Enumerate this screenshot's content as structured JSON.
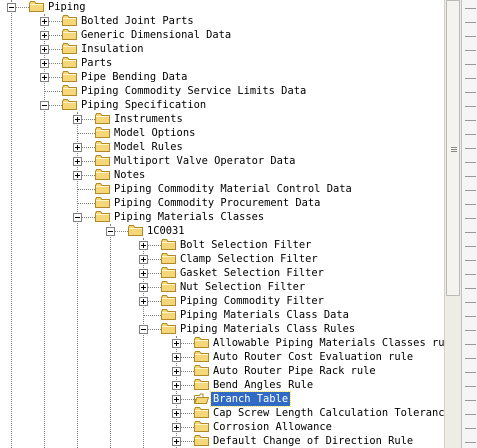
{
  "tree": [
    {
      "label": "Piping",
      "level": 0,
      "state": "minus"
    },
    {
      "label": "Bolted Joint Parts",
      "level": 1,
      "state": "plus"
    },
    {
      "label": "Generic Dimensional Data",
      "level": 1,
      "state": "plus"
    },
    {
      "label": "Insulation",
      "level": 1,
      "state": "plus"
    },
    {
      "label": "Parts",
      "level": 1,
      "state": "plus"
    },
    {
      "label": "Pipe Bending Data",
      "level": 1,
      "state": "plus"
    },
    {
      "label": "Piping Commodity Service Limits Data",
      "level": 1,
      "state": "none"
    },
    {
      "label": "Piping Specification",
      "level": 1,
      "state": "minus"
    },
    {
      "label": "Instruments",
      "level": 2,
      "state": "plus"
    },
    {
      "label": "Model Options",
      "level": 2,
      "state": "none"
    },
    {
      "label": "Model Rules",
      "level": 2,
      "state": "plus"
    },
    {
      "label": "Multiport Valve Operator Data",
      "level": 2,
      "state": "plus"
    },
    {
      "label": "Notes",
      "level": 2,
      "state": "plus"
    },
    {
      "label": "Piping Commodity Material Control Data",
      "level": 2,
      "state": "none"
    },
    {
      "label": "Piping Commodity Procurement Data",
      "level": 2,
      "state": "none"
    },
    {
      "label": "Piping Materials Classes",
      "level": 2,
      "state": "minus"
    },
    {
      "label": "1C0031",
      "level": 3,
      "state": "minus"
    },
    {
      "label": "Bolt Selection Filter",
      "level": 4,
      "state": "plus"
    },
    {
      "label": "Clamp Selection Filter",
      "level": 4,
      "state": "plus"
    },
    {
      "label": "Gasket Selection Filter",
      "level": 4,
      "state": "plus"
    },
    {
      "label": "Nut Selection Filter",
      "level": 4,
      "state": "plus"
    },
    {
      "label": "Piping Commodity Filter",
      "level": 4,
      "state": "plus"
    },
    {
      "label": "Piping Materials Class Data",
      "level": 4,
      "state": "none"
    },
    {
      "label": "Piping Materials Class Rules",
      "level": 4,
      "state": "minus"
    },
    {
      "label": "Allowable Piping Materials Classes ru",
      "level": 5,
      "state": "plus"
    },
    {
      "label": "Auto Router Cost Evaluation rule",
      "level": 5,
      "state": "plus"
    },
    {
      "label": "Auto Router Pipe Rack rule",
      "level": 5,
      "state": "plus"
    },
    {
      "label": "Bend Angles Rule",
      "level": 5,
      "state": "plus"
    },
    {
      "label": "Branch Table",
      "level": 5,
      "state": "plus",
      "selected": true,
      "open": true
    },
    {
      "label": "Cap Screw Length Calculation Toleranc",
      "level": 5,
      "state": "plus"
    },
    {
      "label": "Corrosion Allowance",
      "level": 5,
      "state": "plus"
    },
    {
      "label": "Default Change of Direction Rule",
      "level": 5,
      "state": "plus"
    }
  ],
  "colors": {
    "selection": "#316ac5",
    "folder": "#f5d77a",
    "folder_edge": "#b08a26"
  },
  "icons": {
    "folder": "folder-icon",
    "open_folder": "folder-open-icon",
    "expand": "expand-plus-icon",
    "collapse": "collapse-minus-icon"
  }
}
